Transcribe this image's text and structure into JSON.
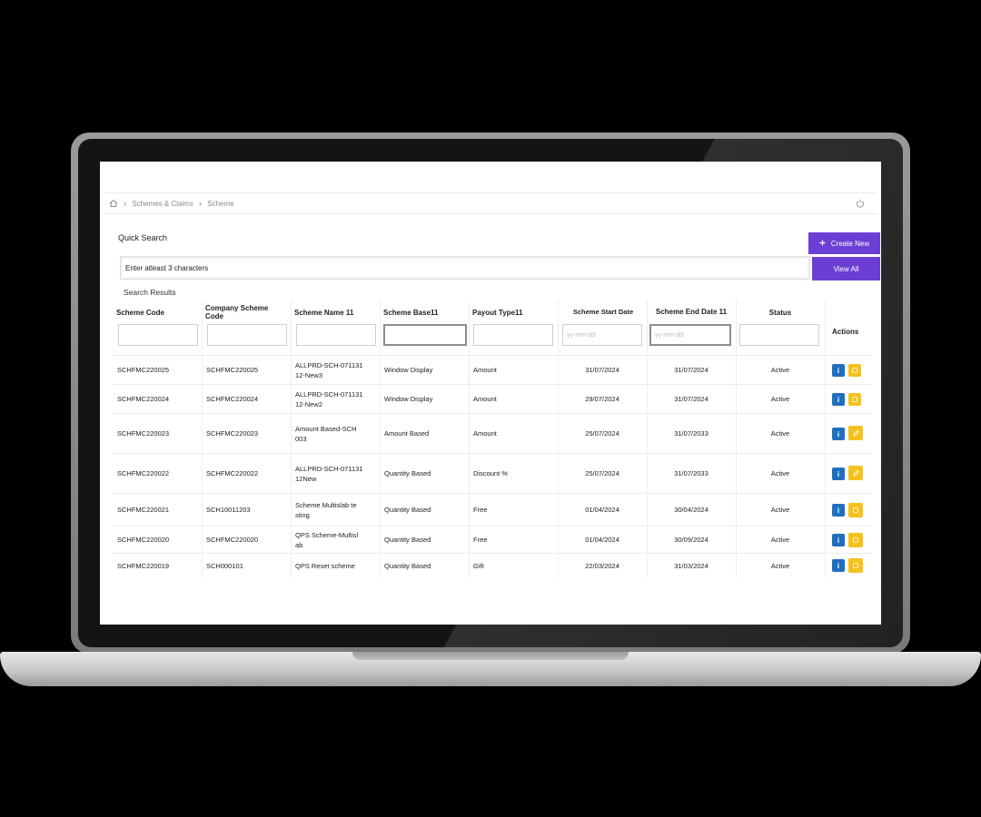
{
  "breadcrumb": {
    "items": [
      "Schemes & Claims",
      "Scheme"
    ]
  },
  "quick_search": {
    "label": "Quick Search",
    "placeholder": "Enter atleast 3 characters"
  },
  "buttons": {
    "create_new": "Create New",
    "view_all": "View All"
  },
  "results_label": "Search Results",
  "table": {
    "columns": [
      "Scheme Code",
      "Company Scheme Code",
      "Scheme Name 11",
      "Scheme Base11",
      "Payout Type11",
      "Scheme Start Date",
      "Scheme End Date 11",
      "Status",
      "Actions"
    ],
    "date_placeholder": "yy-mm-dd",
    "rows": [
      {
        "code": "SCHFMC220025",
        "company_code": "SCHFMC220025",
        "name": "ALLPRD-SCH-071131\n12-New3",
        "base": "Window Display",
        "payout": "Amount",
        "start": "31/07/2024",
        "end": "31/07/2024",
        "status": "Active"
      },
      {
        "code": "SCHFMC220024",
        "company_code": "SCHFMC220024",
        "name": "ALLPRD-SCH-071131\n12-New2",
        "base": "Window Display",
        "payout": "Amount",
        "start": "29/07/2024",
        "end": "31/07/2024",
        "status": "Active"
      },
      {
        "code": "SCHFMC220023",
        "company_code": "SCHFMC220023",
        "name": "Amount Based-SCH\n003",
        "base": "Amount Based",
        "payout": "Amount",
        "start": "25/07/2024",
        "end": "31/07/2033",
        "status": "Active"
      },
      {
        "code": "SCHFMC220022",
        "company_code": "SCHFMC220022",
        "name": "ALLPRD-SCH-071131\n12New",
        "base": "Quantity Based",
        "payout": "Discount %",
        "start": "25/07/2024",
        "end": "31/07/2033",
        "status": "Active"
      },
      {
        "code": "SCHFMC220021",
        "company_code": "SCH10011203",
        "name": "Scheme Multislab te\nsting",
        "base": "Quantity Based",
        "payout": "Free",
        "start": "01/04/2024",
        "end": "30/04/2024",
        "status": "Active"
      },
      {
        "code": "SCHFMC220020",
        "company_code": "SCHFMC220020",
        "name": "QPS Scheme-Multisl\nab",
        "base": "Quantity Based",
        "payout": "Free",
        "start": "01/04/2024",
        "end": "30/09/2024",
        "status": "Active"
      },
      {
        "code": "SCHFMC220019",
        "company_code": "SCH000101",
        "name": "QPS Reset scheme",
        "base": "Quantity Based",
        "payout": "Gift",
        "start": "22/03/2024",
        "end": "31/03/2024",
        "status": "Active"
      }
    ]
  },
  "icons": {
    "home": "home-icon",
    "power": "power-icon",
    "plus": "plus-icon",
    "info": "info-icon",
    "edit": "edit-icon"
  },
  "colors": {
    "primary": "#6b3fd4",
    "info": "#1f6fbf",
    "edit": "#f4c21c"
  }
}
